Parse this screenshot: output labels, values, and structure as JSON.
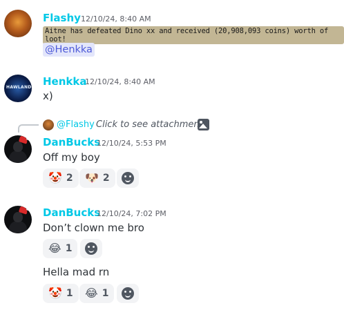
{
  "messages": [
    {
      "author": "Flashy",
      "timestamp": "12/10/24, 8:40 AM",
      "loot_text": "Aitne has defeated Dino xx and received (20,908,093 coins) worth of loot!",
      "mention": "@Henkka"
    },
    {
      "author": "Henkka",
      "timestamp": "12/10/24, 8:40 AM",
      "avatar_text": "HAWLAND",
      "text": "x)"
    },
    {
      "reply": {
        "mention": "@Flashy",
        "text": "Click to see attachment",
        "icon": "image-icon"
      },
      "author": "DanBucks",
      "timestamp": "12/10/24, 5:53 PM",
      "text": "Off my boy",
      "reactions": [
        {
          "emoji": "🤡",
          "count": "2"
        },
        {
          "emoji": "🐶",
          "count": "2"
        }
      ]
    },
    {
      "author": "DanBucks",
      "timestamp": "12/10/24, 7:02 PM",
      "text": "Don’t clown me bro",
      "reactions": [
        {
          "emoji": "😂",
          "count": "1"
        }
      ],
      "followup_text": "Hella mad rn",
      "followup_reactions": [
        {
          "emoji": "🤡",
          "count": "1"
        },
        {
          "emoji": "😂",
          "count": "1"
        }
      ]
    }
  ],
  "colors": {
    "author": "#00c8e6",
    "mention_bg": "#e3e6fb",
    "mention_fg": "#4e5ad8",
    "reaction_bg": "#f2f3f5",
    "loot_bg": "#c2b694"
  }
}
